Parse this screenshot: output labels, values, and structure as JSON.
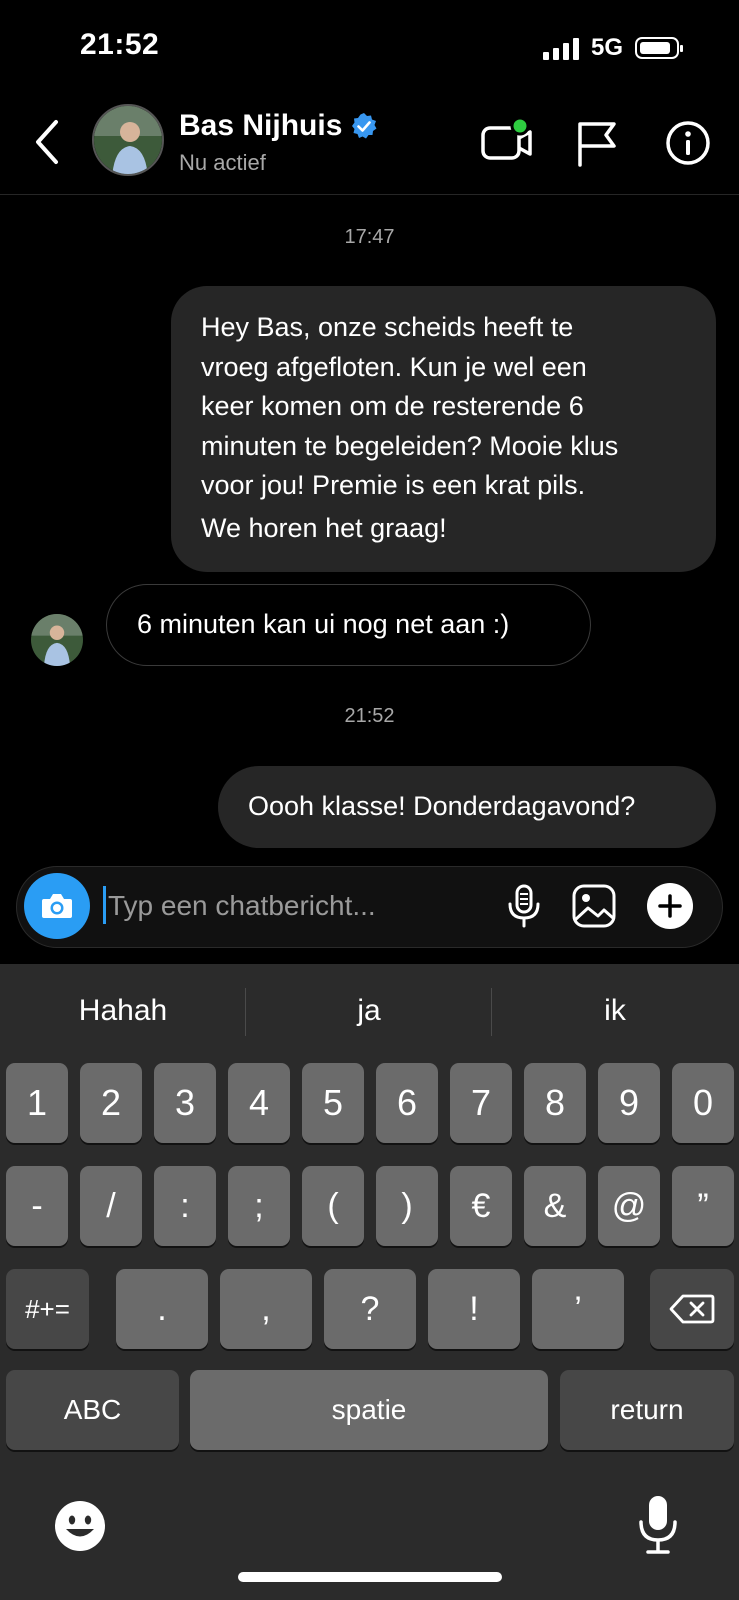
{
  "status_bar": {
    "time": "21:52",
    "network": "5G"
  },
  "header": {
    "name": "Bas Nijhuis",
    "status": "Nu actief"
  },
  "chat": {
    "timestamp1": "17:47",
    "msg_out1_lines": [
      "Hey Bas, onze scheids heeft te",
      "vroeg afgefloten. Kun je wel een",
      "keer komen om de resterende 6",
      "minuten te begeleiden? Mooie klus",
      "voor jou! Premie is een krat pils.",
      "We horen het graag!"
    ],
    "msg_in1": "6 minuten kan ui nog net aan :)",
    "timestamp2": "21:52",
    "msg_out2": "Oooh klasse! Donderdagavond?"
  },
  "composer": {
    "placeholder": "Typ een chatbericht..."
  },
  "keyboard": {
    "suggestions": [
      "Hahah",
      "ja",
      "ik"
    ],
    "row1": [
      "1",
      "2",
      "3",
      "4",
      "5",
      "6",
      "7",
      "8",
      "9",
      "0"
    ],
    "row2": [
      "-",
      "/",
      ":",
      ";",
      "(",
      ")",
      "€",
      "&",
      "@",
      "”"
    ],
    "row3": [
      ".",
      ",",
      "?",
      "!",
      "’"
    ],
    "mode_symbols": "#+=",
    "mode_abc": "ABC",
    "space": "spatie",
    "return": "return"
  },
  "colors": {
    "accent": "#2a9df4",
    "bubble": "#262626",
    "online": "#2ecc40",
    "keyboard_bg": "#2b2b2b",
    "key": "#6b6b6b",
    "key_dark": "#474747"
  },
  "icons": [
    "back-chevron-icon",
    "verified-badge-icon",
    "video-call-icon",
    "flag-icon",
    "info-icon",
    "camera-icon",
    "microphone-icon",
    "gallery-icon",
    "plus-icon",
    "backspace-icon",
    "emoji-icon",
    "dictation-mic-icon"
  ]
}
